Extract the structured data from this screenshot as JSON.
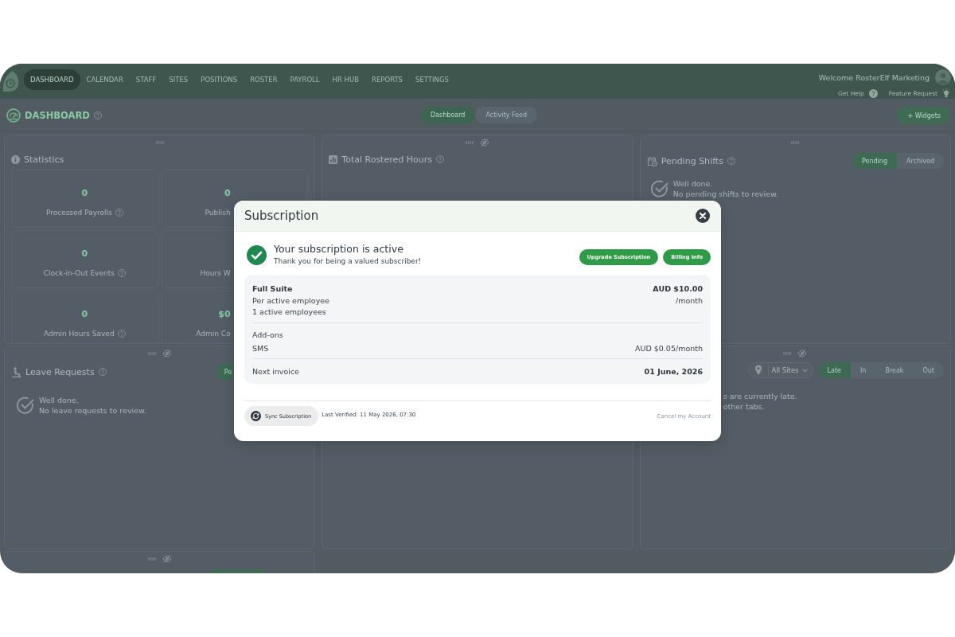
{
  "nav": {
    "items": [
      {
        "label": "DASHBOARD",
        "selected": true
      },
      {
        "label": "CALENDAR",
        "selected": false
      },
      {
        "label": "STAFF",
        "selected": false
      },
      {
        "label": "SITES",
        "selected": false
      },
      {
        "label": "POSITIONS",
        "selected": false
      },
      {
        "label": "ROSTER",
        "selected": false
      },
      {
        "label": "PAYROLL",
        "selected": false
      },
      {
        "label": "HR HUB",
        "selected": false
      },
      {
        "label": "REPORTS",
        "selected": false
      },
      {
        "label": "SETTINGS",
        "selected": false
      }
    ],
    "welcome": "Welcome RosterElf Marketing",
    "links": [
      {
        "label": "Get Help",
        "kind": "help"
      },
      {
        "label": "Feature Request",
        "kind": "idea"
      }
    ]
  },
  "page_header": {
    "title": "DASHBOARD",
    "help": true,
    "views": [
      {
        "label": "Dashboard",
        "selected": true
      },
      {
        "label": "Activity Feed",
        "selected": false
      }
    ],
    "add_button": "+ Widgets"
  },
  "columns": [
    {
      "widgets": [
        {
          "kind": "statistics",
          "title": "Statistics",
          "help": false,
          "hideable": false,
          "stats": [
            {
              "value": "0",
              "label": "Processed Payrolls",
              "help": true
            },
            {
              "value": "0",
              "label": "Publish",
              "help": false
            },
            {
              "value": "0",
              "label": "Clock-in-Out Events",
              "help": true
            },
            {
              "label": "Hours W",
              "help": false
            },
            {
              "value": "0",
              "label": "Admin Hours Saved",
              "help": true
            },
            {
              "value": "$0",
              "label": "Admin Co",
              "help": false
            }
          ]
        },
        {
          "kind": "leave",
          "title": "Leave Requests",
          "help": true,
          "hideable": true,
          "button": "Pe",
          "message": "Well done.",
          "detail": "No leave requests to review."
        },
        {
          "kind": "stub",
          "hideable": true
        }
      ]
    },
    {
      "widgets": [
        {
          "kind": "rostered",
          "title": "Total Rostered Hours",
          "help": true,
          "hideable": true
        }
      ]
    },
    {
      "widgets": [
        {
          "kind": "pending",
          "title": "Pending Shifts",
          "help": true,
          "hideable": false,
          "tabs": [
            {
              "label": "Pending",
              "selected": true
            },
            {
              "label": "Archived",
              "selected": false
            }
          ],
          "message": "Well done.",
          "detail": "No pending shifts to review."
        },
        {
          "kind": "clock",
          "hideable": true,
          "site": "All Sites",
          "tabs": [
            {
              "label": "Late",
              "selected": true
            },
            {
              "label": "In",
              "selected": false
            },
            {
              "label": "Break",
              "selected": false
            },
            {
              "label": "Out",
              "selected": false
            }
          ],
          "message": "s are currently late.",
          "detail": "other tabs."
        }
      ]
    }
  ],
  "modal": {
    "title": "Subscription",
    "status": {
      "heading": "Your subscription is active",
      "text": "Thank you for being a valued subscriber!"
    },
    "actions": [
      "Upgrade Subscription",
      "Billing Info"
    ],
    "plan": {
      "name": "Full Suite",
      "price": "AUD $10.00",
      "period": "/month",
      "lines": [
        "Per active employee",
        "1 active employees"
      ]
    },
    "addons": {
      "title": "Add-ons",
      "items": [
        {
          "name": "SMS",
          "price": "AUD $0.05/month"
        }
      ]
    },
    "invoice": {
      "label": "Next invoice",
      "date": "01 June, 2026"
    },
    "sync_button": "Sync Subscription",
    "last_verified": "Last Verified: 11 May 2026, 07:30",
    "cancel_link": "Cancel my Account"
  }
}
